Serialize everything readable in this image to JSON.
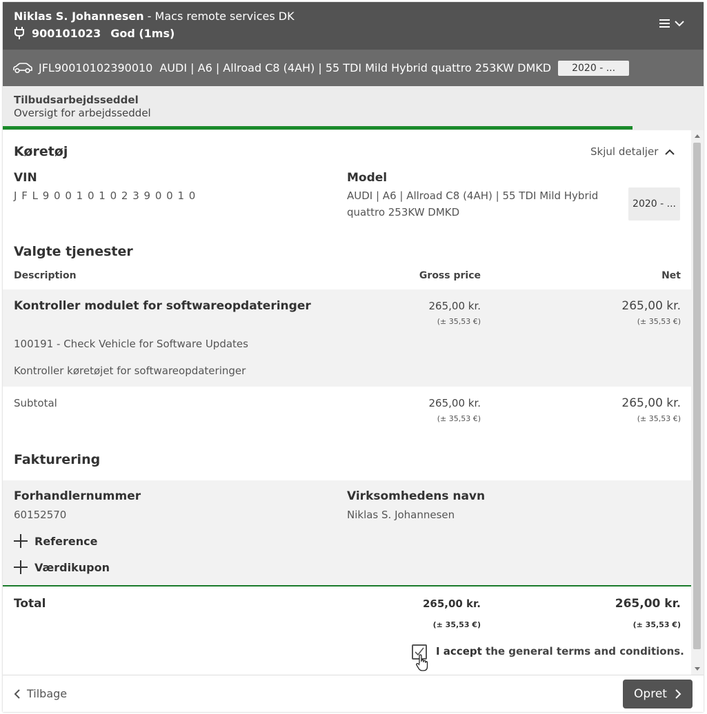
{
  "header": {
    "user_name": "Niklas S. Johannesen",
    "company": " - Macs remote services DK",
    "device_id": "900101023",
    "connection_status": "God (1ms)",
    "plug_icon": "plug-icon",
    "menu_icon": "hamburger-menu-icon"
  },
  "vehicle_bar": {
    "vin": "JFL90010102390010",
    "model": "AUDI | A6 | Allroad C8 (4AH) | 55 TDI Mild Hybrid quattro 253KW DMKD",
    "year": "2020 - ..."
  },
  "subheader": {
    "title": "Tilbudsarbejdsseddel",
    "subtitle": "Oversigt for arbejdsseddel",
    "progress_fraction": 0.9
  },
  "vehicle_section": {
    "title": "Køretøj",
    "toggle_label": "Skjul detaljer",
    "vin_label": "VIN",
    "vin_value": "J F L 9 0 0 1 0 1 0 2 3 9 0 0 1 0",
    "model_label": "Model",
    "model_line1": "AUDI | A6 | Allroad C8 (4AH) | 55 TDI Mild Hybrid",
    "model_line2": "quattro 253KW DMKD",
    "year": "2020 - ..."
  },
  "services": {
    "title": "Valgte tjenester",
    "columns": {
      "description": "Description",
      "gross": "Gross price",
      "net": "Net"
    },
    "items": [
      {
        "name": "Kontroller modulet for softwareopdateringer",
        "gross": "265,00 kr.",
        "gross_eur": "(± 35,53 €)",
        "net": "265,00 kr.",
        "net_eur": "(± 35,53 €)",
        "code_line": "100191 - Check Vehicle for Software Updates",
        "description": "Kontroller køretøjet for softwareopdateringer"
      }
    ],
    "subtotal_label": "Subtotal",
    "subtotal_gross": "265,00 kr.",
    "subtotal_gross_eur": "(± 35,53 €)",
    "subtotal_net": "265,00 kr.",
    "subtotal_net_eur": "(± 35,53 €)"
  },
  "billing": {
    "title": "Fakturering",
    "dealer_label": "Forhandlernummer",
    "dealer_value": "60152570",
    "company_label": "Virksomhedens navn",
    "company_value": "Niklas S. Johannesen",
    "reference_label": "Reference",
    "voucher_label": "Værdikupon"
  },
  "total": {
    "label": "Total",
    "gross": "265,00 kr.",
    "gross_eur": "(± 35,53 €)",
    "net": "265,00 kr.",
    "net_eur": "(± 35,53 €)"
  },
  "terms": {
    "accept_bold": "I accept",
    "accept_rest": " the general terms and conditions.",
    "checked": true
  },
  "footer": {
    "back_label": "Tilbage",
    "create_label": "Opret"
  },
  "colors": {
    "header_bg": "#535353",
    "vehicle_bar_bg": "#6b6b6b",
    "accent_green": "#1a8a2a"
  }
}
